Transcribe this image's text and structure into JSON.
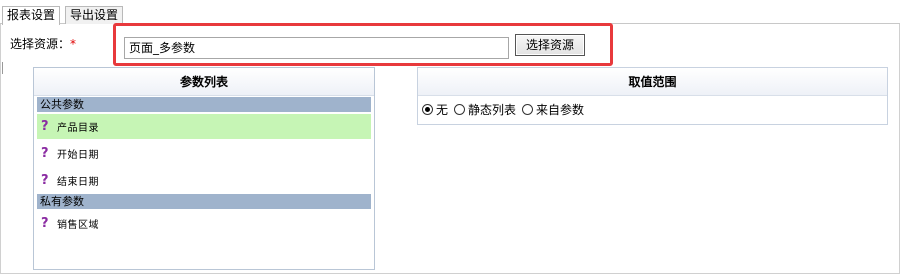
{
  "tabs": [
    {
      "label": "报表设置",
      "active": true
    },
    {
      "label": "导出设置",
      "active": false
    }
  ],
  "resource": {
    "label": "选择资源：",
    "required_mark": "*",
    "value": "页面_多参数",
    "button_label": "选择资源"
  },
  "param_list": {
    "header": "参数列表",
    "groups": [
      {
        "label": "公共参数",
        "items": [
          {
            "icon": "question-icon",
            "glyph": "?",
            "label": "产品目录",
            "selected": true
          },
          {
            "icon": "question-icon",
            "glyph": "?",
            "label": "开始日期",
            "selected": false
          },
          {
            "icon": "question-icon",
            "glyph": "?",
            "label": "结束日期",
            "selected": false
          }
        ]
      },
      {
        "label": "私有参数",
        "items": [
          {
            "icon": "question-icon",
            "glyph": "?",
            "label": "销售区域",
            "selected": false
          }
        ]
      }
    ]
  },
  "value_range": {
    "header": "取值范围",
    "options": [
      {
        "label": "无",
        "checked": true
      },
      {
        "label": "静态列表",
        "checked": false
      },
      {
        "label": "来自参数",
        "checked": false
      }
    ]
  },
  "colors": {
    "highlight_border": "#e8393c",
    "selected_row": "#c6f5b5",
    "group_header": "#9fb3cc",
    "question_icon": "#8a2ba2",
    "required_star": "#e00000"
  }
}
